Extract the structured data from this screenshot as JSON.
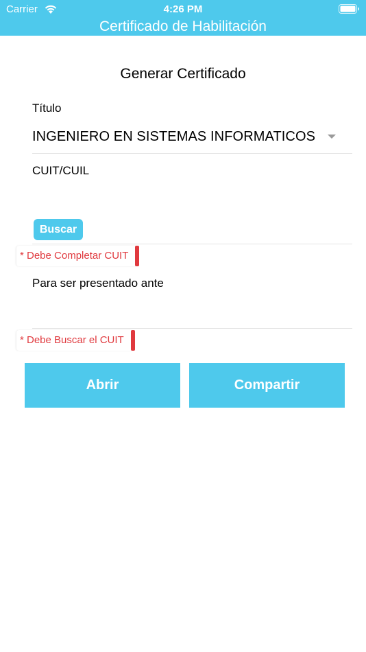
{
  "status": {
    "carrier": "Carrier",
    "time": "4:26 PM",
    "wifi_icon": "wifi-icon",
    "battery_icon": "battery-icon"
  },
  "app": {
    "title": "Certificado de Habilitación",
    "accent_color": "#4ec9ec",
    "error_color": "#e0393e"
  },
  "form": {
    "heading": "Generar Certificado",
    "titulo_label": "Título",
    "titulo_value": "INGENIERO EN SISTEMAS INFORMATICOS",
    "dropdown_icon": "caret-down-icon",
    "cuit_label": "CUIT/CUIL",
    "cuit_value": "",
    "buscar_label": "Buscar",
    "cuit_error": "* Debe Completar CUIT",
    "presentado_label": "Para ser presentado ante",
    "presentado_value": "",
    "buscar_error": "* Debe Buscar el CUIT"
  },
  "actions": {
    "abrir_label": "Abrir",
    "compartir_label": "Compartir"
  }
}
